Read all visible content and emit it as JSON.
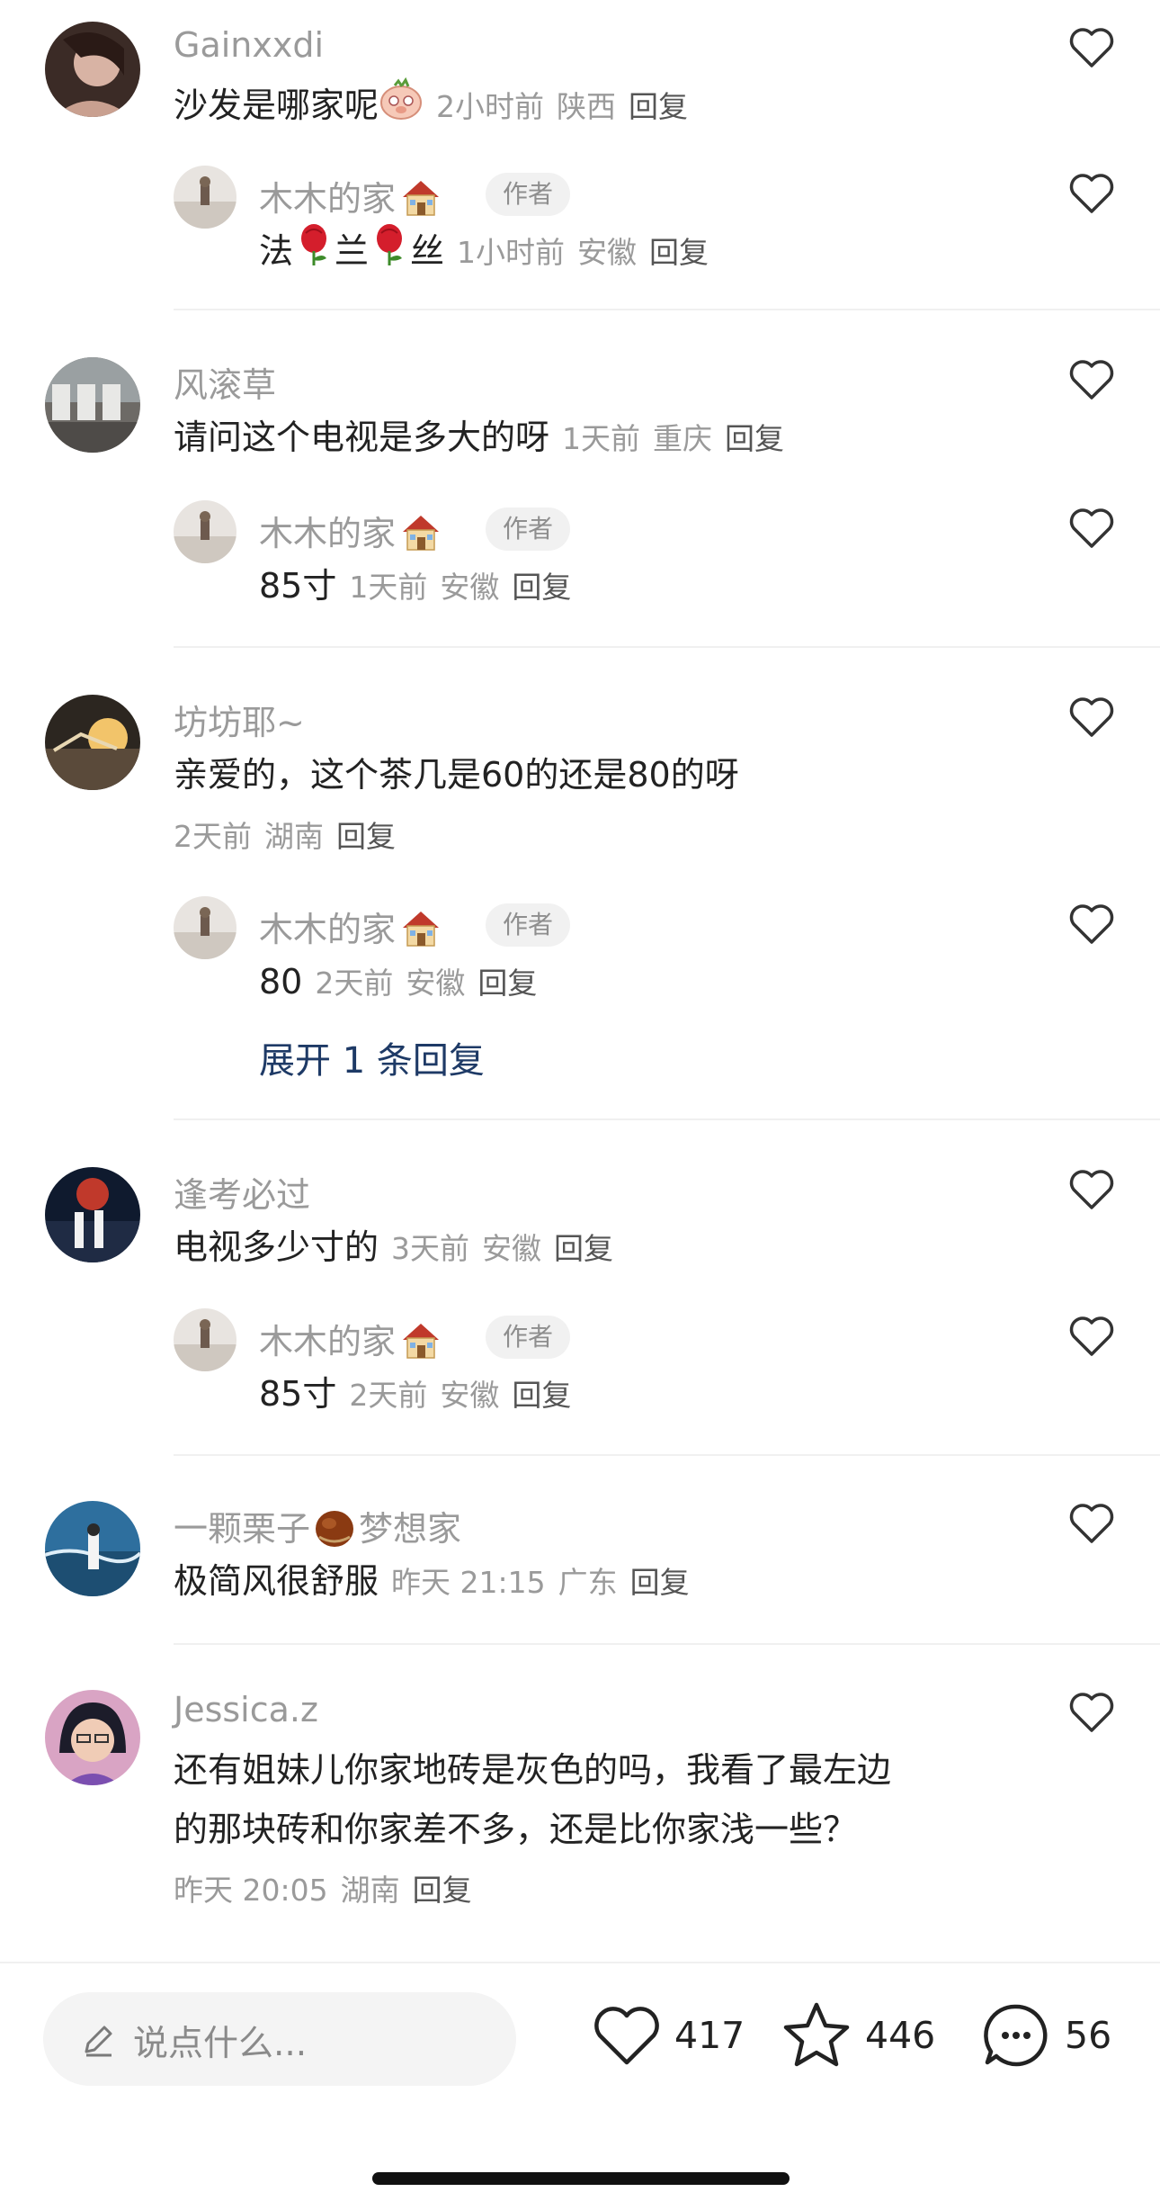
{
  "threads": [
    {
      "comment": {
        "user": "Gainxxdi",
        "text": "沙发是哪家呢",
        "emoji": "pig",
        "time": "2小时前",
        "location": "陕西",
        "reply_label": "回复"
      },
      "replies": [
        {
          "user": "木木的家",
          "badge": "作者",
          "parts": [
            "法",
            "rose",
            "兰",
            "rose",
            "丝"
          ],
          "time": "1小时前",
          "location": "安徽",
          "reply_label": "回复"
        }
      ]
    },
    {
      "comment": {
        "user": "风滚草",
        "text": "请问这个电视是多大的呀",
        "time": "1天前",
        "location": "重庆",
        "reply_label": "回复"
      },
      "replies": [
        {
          "user": "木木的家",
          "badge": "作者",
          "text": "85寸",
          "time": "1天前",
          "location": "安徽",
          "reply_label": "回复"
        }
      ]
    },
    {
      "comment": {
        "user": "坊坊耶~",
        "text": "亲爱的，这个茶几是60的还是80的呀",
        "time": "2天前",
        "location": "湖南",
        "reply_label": "回复"
      },
      "replies": [
        {
          "user": "木木的家",
          "badge": "作者",
          "text": "80",
          "time": "2天前",
          "location": "安徽",
          "reply_label": "回复"
        }
      ],
      "expand": "展开 1 条回复"
    },
    {
      "comment": {
        "user": "逢考必过",
        "text": "电视多少寸的",
        "time": "3天前",
        "location": "安徽",
        "reply_label": "回复"
      },
      "replies": [
        {
          "user": "木木的家",
          "badge": "作者",
          "text": "85寸",
          "time": "2天前",
          "location": "安徽",
          "reply_label": "回复"
        }
      ]
    },
    {
      "comment": {
        "user": "一颗栗子",
        "user_suffix": "梦想家",
        "text": "极简风很舒服",
        "time": "昨天 21:15",
        "location": "广东",
        "reply_label": "回复"
      }
    },
    {
      "comment": {
        "user": "Jessica.z",
        "text_line1": "还有姐妹儿你家地砖是灰色的吗，我看了最左边",
        "text_line2": "的那块砖和你家差不多，还是比你家浅一些？",
        "time": "昨天 20:05",
        "location": "湖南",
        "reply_label": "回复"
      }
    }
  ],
  "bottom_bar": {
    "input_placeholder": "说点什么...",
    "likes": "417",
    "favorites": "446",
    "comments": "56"
  },
  "icons": {
    "like": "heart-outline-icon",
    "favorite": "star-outline-icon",
    "comment": "chat-bubble-icon",
    "compose": "pencil-icon"
  }
}
